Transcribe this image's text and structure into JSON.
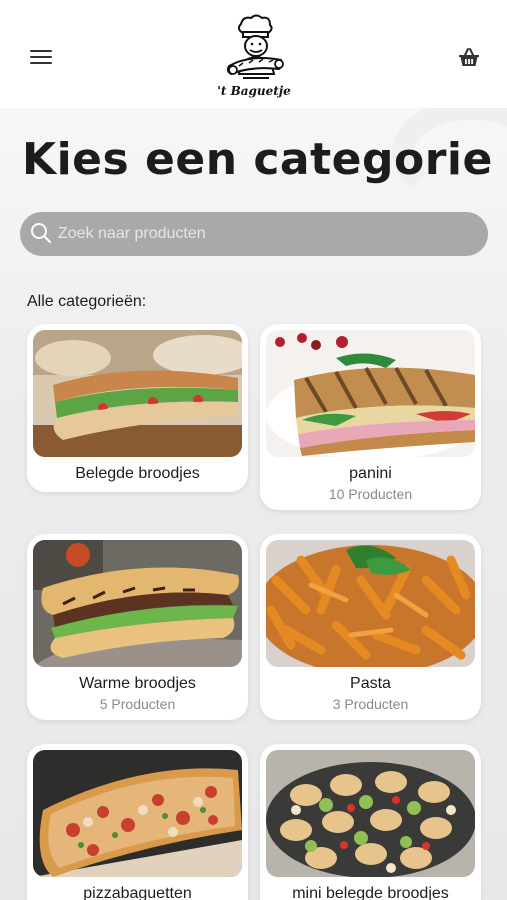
{
  "header": {
    "logo_text": "'t Baguetje",
    "menu_icon": "hamburger-menu-icon",
    "basket_icon": "shopping-basket-icon"
  },
  "page_title": "Kies een categorie",
  "search": {
    "placeholder": "Zoek naar producten",
    "value": ""
  },
  "section_label": "Alle categorieën:",
  "categories": [
    {
      "name": "Belegde broodjes",
      "count": ""
    },
    {
      "name": "panini",
      "count": "10 Producten"
    },
    {
      "name": "Warme broodjes",
      "count": "5 Producten"
    },
    {
      "name": "Pasta",
      "count": "3 Producten"
    },
    {
      "name": "pizzabaguetten",
      "count": ""
    },
    {
      "name": "mini belegde broodjes",
      "count": ""
    }
  ]
}
